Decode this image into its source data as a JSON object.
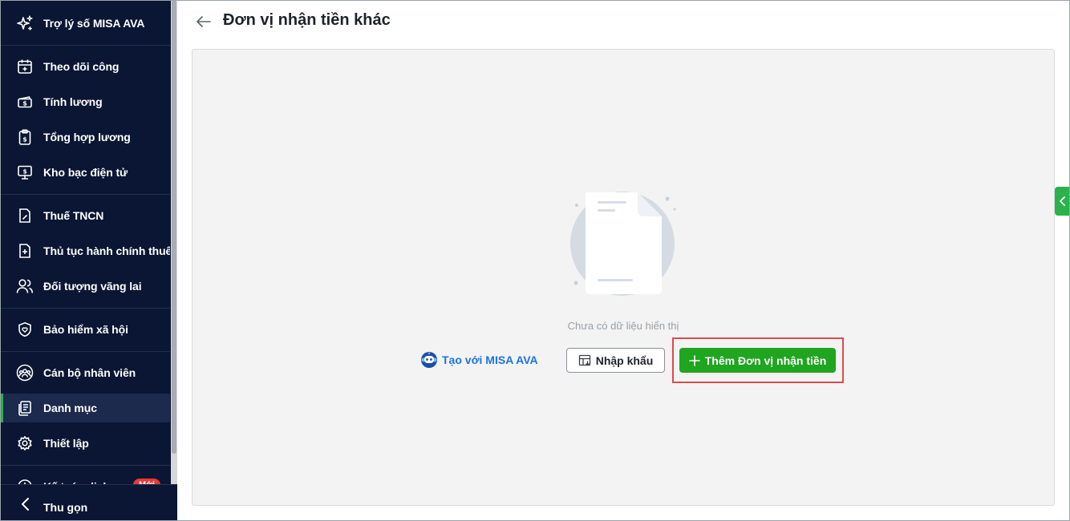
{
  "sidebar": {
    "assistant_label": "Trợ lý số MISA AVA",
    "items": [
      {
        "label": "Theo dõi công",
        "icon": "calendar-plus-icon"
      },
      {
        "label": "Tính lương",
        "icon": "money-icon"
      },
      {
        "label": "Tổng hợp lương",
        "icon": "clipboard-dollar-icon"
      },
      {
        "label": "Kho bạc điện tử",
        "icon": "monitor-dollar-icon"
      },
      {
        "label": "Thuế TNCN",
        "icon": "tax-document-icon"
      },
      {
        "label": "Thủ tục hành chính thuế",
        "icon": "document-plus-icon"
      },
      {
        "label": "Đối tượng vãng lai",
        "icon": "users-icon"
      },
      {
        "label": "Bảo hiểm xã hội",
        "icon": "shield-heart-icon"
      },
      {
        "label": "Cán bộ nhân viên",
        "icon": "staff-icon"
      },
      {
        "label": "Danh mục",
        "icon": "list-document-icon",
        "active": true
      },
      {
        "label": "Thiết lập",
        "icon": "gear-icon"
      },
      {
        "label": "Kế toán dịch vụ",
        "icon": "clock-icon"
      }
    ],
    "new_badge": "Mới",
    "collapse_label": "Thu gọn"
  },
  "header": {
    "title": "Đơn vị nhận tiền khác"
  },
  "empty_state": {
    "message": "Chưa có dữ liệu hiển thị",
    "ava_link": "Tạo với MISA AVA",
    "import_button": "Nhập khẩu",
    "add_button": "Thêm Đơn vị nhận tiền"
  },
  "colors": {
    "sidebar_bg": "#0a1633",
    "accent_green": "#1fa51f",
    "link_blue": "#1a73e8",
    "highlight_red": "#e24a4a"
  }
}
